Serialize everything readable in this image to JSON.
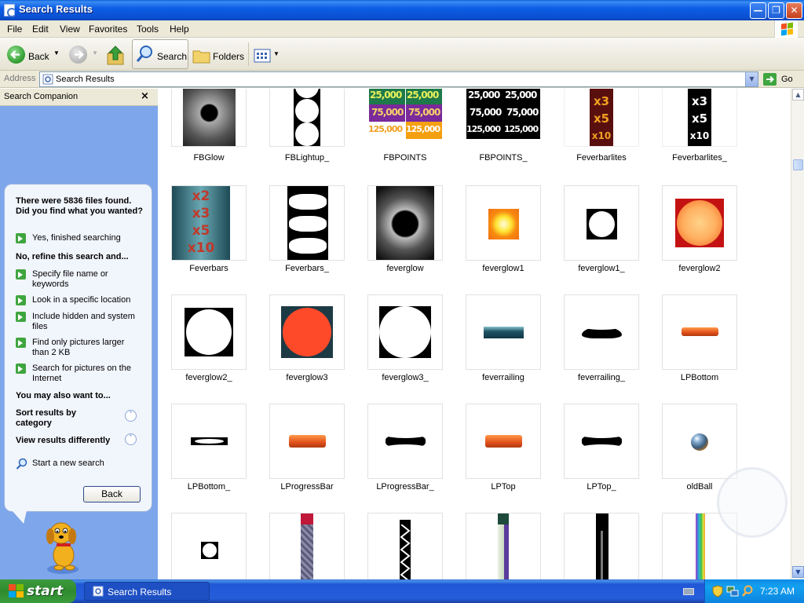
{
  "window": {
    "title": "Search Results",
    "accent": "#0a4fcf"
  },
  "menu": [
    "File",
    "Edit",
    "View",
    "Favorites",
    "Tools",
    "Help"
  ],
  "toolbar": {
    "back": "Back",
    "search": "Search",
    "folders": "Folders"
  },
  "address": {
    "label": "Address",
    "value": "Search Results",
    "go": "Go"
  },
  "companion": {
    "title": "Search Companion",
    "found": "There were 5836 files found. Did you find what you wanted?",
    "yes": "Yes, finished searching",
    "refine_heading": "No, refine this search and...",
    "refine_options": [
      "Specify file name or keywords",
      "Look in a specific location",
      "Include hidden and system files",
      "Find only pictures larger than 2 KB",
      "Search for pictures on the Internet"
    ],
    "also_heading": "You may also want to...",
    "sort": "Sort results by category",
    "view": "View results differently",
    "new_search": "Start a new search",
    "back_button": "Back"
  },
  "files": [
    "FBGlow",
    "FBLightup_",
    "FBPOINTS",
    "FBPOINTS_",
    "Feverbarlites",
    "Feverbarlites_",
    "Feverbars",
    "Feverbars_",
    "feverglow",
    "feverglow1",
    "feverglow1_",
    "feverglow2",
    "feverglow2_",
    "feverglow3",
    "feverglow3_",
    "feverrailing",
    "feverrailing_",
    "LPBottom",
    "LPBottom_",
    "LProgressBar",
    "LProgressBar_",
    "LPTop",
    "LPTop_",
    "oldBall",
    "",
    "",
    "",
    "",
    "",
    ""
  ],
  "points_text": {
    "a": "25,000",
    "b": "75,000",
    "c": "125,000"
  },
  "fever_text": [
    "x2",
    "x3",
    "x5",
    "x10"
  ],
  "taskbar": {
    "start": "start",
    "task": "Search Results",
    "clock": "7:23 AM"
  }
}
